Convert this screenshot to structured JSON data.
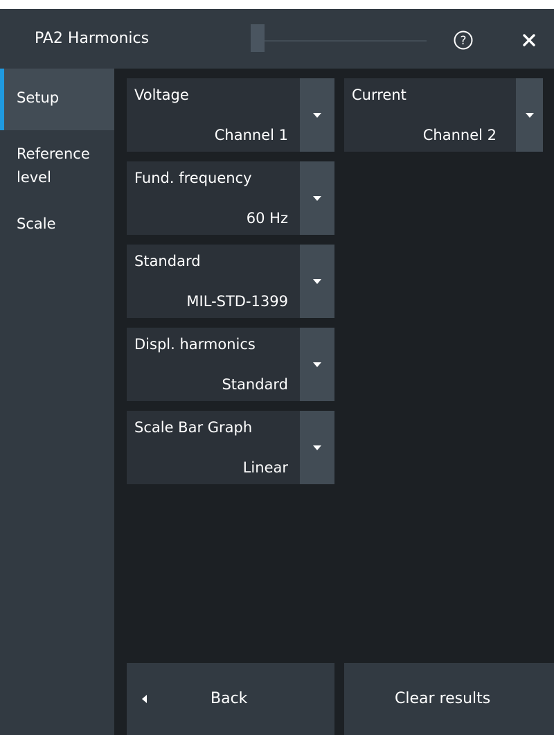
{
  "dialog": {
    "title": "PA2 Harmonics",
    "help_icon": "help-circle-icon",
    "close_icon": "close-icon"
  },
  "sidebar": {
    "items": [
      {
        "label": "Setup",
        "active": true
      },
      {
        "label": "Reference level",
        "line1": "Reference",
        "line2": "level",
        "active": false
      },
      {
        "label": "Scale",
        "active": false
      }
    ]
  },
  "fields": {
    "voltage": {
      "label": "Voltage",
      "value": "Channel 1"
    },
    "current": {
      "label": "Current",
      "value": "Channel 2"
    },
    "fund_frequency": {
      "label": "Fund. frequency",
      "value": "60 Hz"
    },
    "standard": {
      "label": "Standard",
      "value": "MIL-STD-1399"
    },
    "displ_harmonics": {
      "label": "Displ. harmonics",
      "value": "Standard"
    },
    "scale_bar_graph": {
      "label": "Scale Bar Graph",
      "value": "Linear"
    }
  },
  "footer": {
    "back_label": "Back",
    "clear_label": "Clear results"
  },
  "colors": {
    "accent": "#1f9ae0",
    "titlebar": "#323a42",
    "background": "#1c2024"
  }
}
